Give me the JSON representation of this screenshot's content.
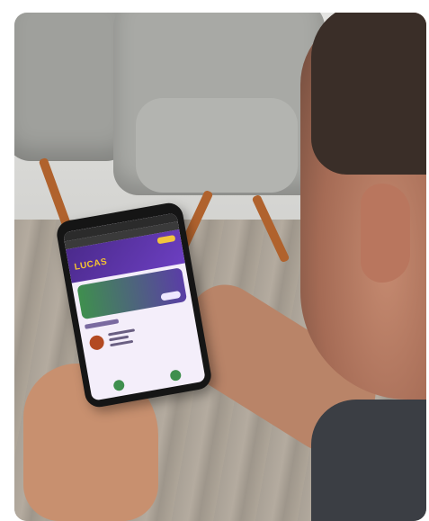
{
  "scene": {
    "description_icons": [
      "armchair-icon",
      "smartphone-icon"
    ]
  },
  "phone_app": {
    "logo_text": "LUCAS"
  },
  "colors": {
    "app_header": "#5a35a8",
    "app_logo": "#f5c330",
    "app_accent_green": "#3f8f4e",
    "chair_legs": "#b0622d"
  }
}
